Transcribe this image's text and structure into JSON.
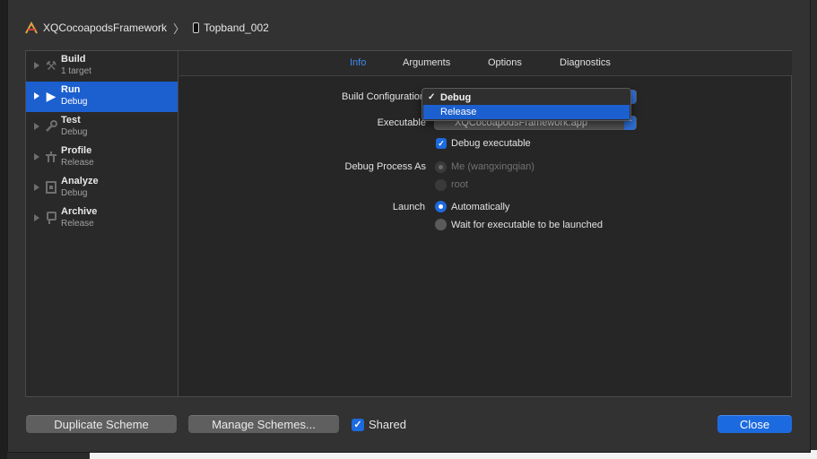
{
  "breadcrumb": {
    "project": "XQCocoapodsFramework",
    "separator": "〉",
    "device": "Topband_002"
  },
  "sidebar": {
    "items": [
      {
        "name": "Build",
        "sub": "1 target",
        "icon": "hammer-icon",
        "glyph": "⚒"
      },
      {
        "name": "Run",
        "sub": "Debug",
        "icon": "play-icon",
        "glyph": "▶"
      },
      {
        "name": "Test",
        "sub": "Debug",
        "icon": "wrench-icon",
        "glyph": "🔧"
      },
      {
        "name": "Profile",
        "sub": "Release",
        "icon": "instruments-icon",
        "glyph": "⚗"
      },
      {
        "name": "Analyze",
        "sub": "Debug",
        "icon": "analyze-icon",
        "glyph": "▣"
      },
      {
        "name": "Archive",
        "sub": "Release",
        "icon": "archive-icon",
        "glyph": "⎙"
      }
    ],
    "selected": "Run"
  },
  "tabs": [
    "Info",
    "Arguments",
    "Options",
    "Diagnostics"
  ],
  "active_tab": "Info",
  "info": {
    "build_config_label": "Build Configuration",
    "build_config_options": [
      "Debug",
      "Release"
    ],
    "build_config_selected": "Debug",
    "build_config_highlighted": "Release",
    "checkmark": "✓",
    "executable_label": "Executable",
    "executable_value": "XQCocoapodsFramework.app",
    "debug_executable_label": "Debug executable",
    "debug_process_label": "Debug Process As",
    "debug_process_options": [
      "Me (wangxingqian)",
      "root"
    ],
    "launch_label": "Launch",
    "launch_options": [
      "Automatically",
      "Wait for executable to be launched"
    ]
  },
  "footer": {
    "duplicate": "Duplicate Scheme",
    "manage": "Manage Schemes...",
    "shared": "Shared",
    "close": "Close"
  },
  "colors": {
    "accent": "#1c6ae0",
    "selection": "#1c5fcf",
    "active_tab": "#3f8cf0"
  }
}
